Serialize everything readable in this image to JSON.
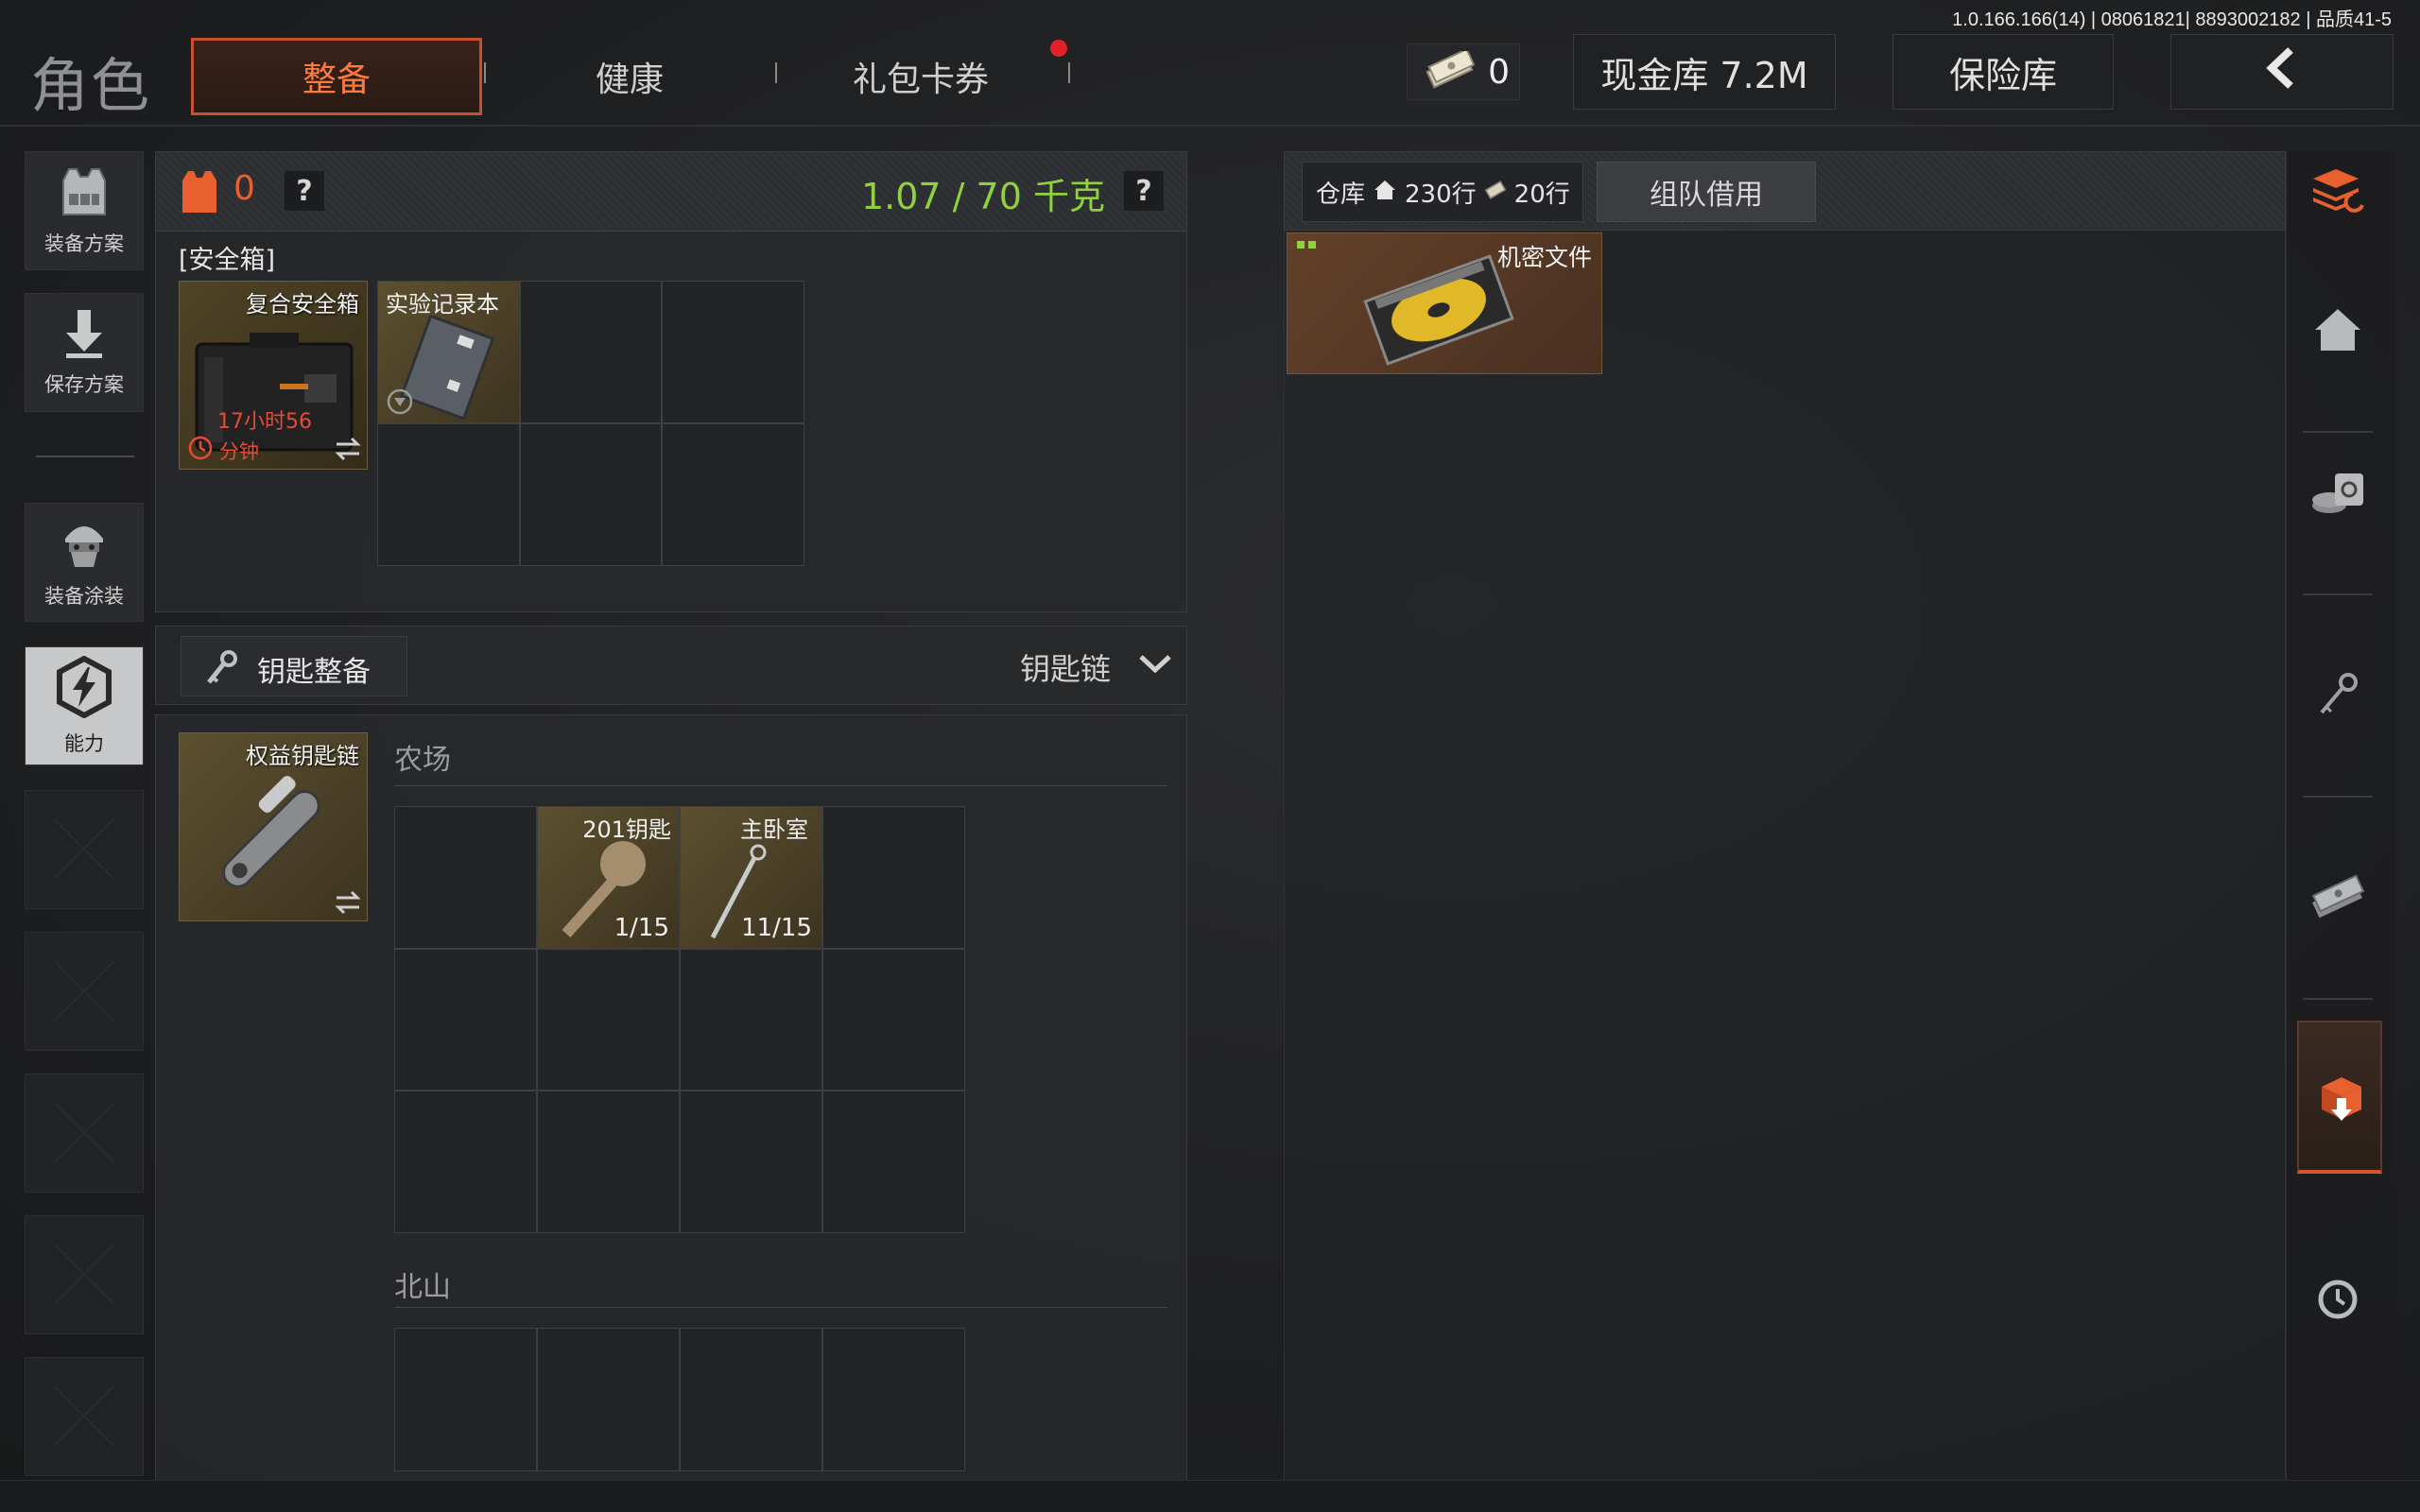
{
  "version_info": "1.0.166.166(14) | 08061821| 8893002182 | 品质41-5",
  "header": {
    "title": "角色",
    "tabs": [
      {
        "label": "整备",
        "active": true
      },
      {
        "label": "健康",
        "active": false
      },
      {
        "label": "礼包卡券",
        "active": false
      }
    ],
    "cash_count": "0",
    "cash_vault_label": "现金库 7.2M",
    "safe_vault_label": "保险库"
  },
  "sidebar": {
    "items": [
      {
        "label": "装备方案",
        "icon": "vest-icon"
      },
      {
        "label": "保存方案",
        "icon": "download-icon"
      },
      {
        "label": "装备涂装",
        "icon": "soldier-helmet-icon"
      },
      {
        "label": "能力",
        "icon": "lightning-shield-icon",
        "active": true
      }
    ]
  },
  "loadout": {
    "armor_count": "0",
    "help": "?",
    "weight_text": "1.07 / 70 千克",
    "weight_color": "#8fd13f",
    "safe_box_label": "[安全箱]",
    "safe_box_item": {
      "name": "复合安全箱",
      "timer": "17小时56",
      "timer_unit": "分钟",
      "timer_color": "#e84a36"
    },
    "lab_notebook": {
      "name": "实验记录本"
    },
    "keys_label": "钥匙整备",
    "keychain_dropdown": "钥匙链",
    "keychain_item": {
      "name": "权益钥匙链"
    },
    "sections": [
      {
        "name": "农场",
        "keys": [
          {
            "name": "201钥匙",
            "uses": "1/15"
          },
          {
            "name": "主卧室",
            "uses": "11/15"
          }
        ]
      },
      {
        "name": "北山",
        "keys": []
      }
    ]
  },
  "warehouse": {
    "title": "仓库",
    "rows_home": "230行",
    "rows_extra": "20行",
    "team_borrow": "组队借用",
    "items": [
      {
        "name": "机密文件",
        "bg_color": "#5a3b24"
      }
    ]
  },
  "right_sidebar": {
    "icons": [
      "stack-refresh-icon",
      "home-icon",
      "safe-icon",
      "key-icon",
      "cash-icon",
      "box-download-icon",
      "clock-icon"
    ],
    "active_index": 5
  }
}
